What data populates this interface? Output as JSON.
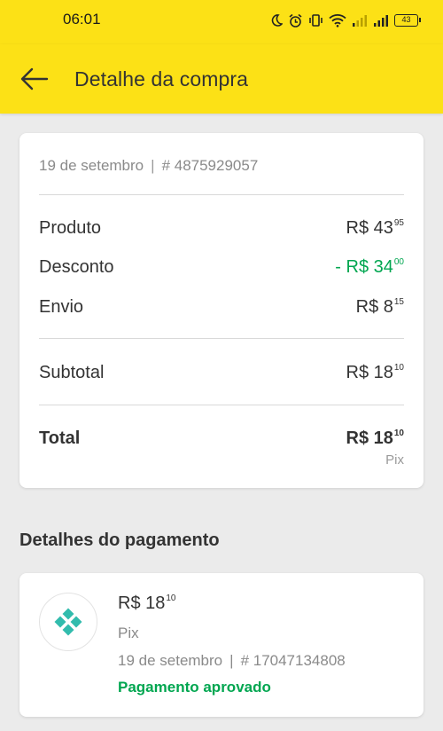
{
  "status_bar": {
    "time": "06:01",
    "battery": "43"
  },
  "header": {
    "title": "Detalhe da compra"
  },
  "order": {
    "date": "19 de setembro",
    "separator": "|",
    "number": "# 4875929057"
  },
  "summary": {
    "produto": {
      "label": "Produto",
      "amount": "R$ 43",
      "cents": "95"
    },
    "desconto": {
      "label": "Desconto",
      "amount": "- R$ 34",
      "cents": "00",
      "color": "#00a650"
    },
    "envio": {
      "label": "Envio",
      "amount": "R$ 8",
      "cents": "15"
    },
    "subtotal": {
      "label": "Subtotal",
      "amount": "R$ 18",
      "cents": "10"
    },
    "total": {
      "label": "Total",
      "amount": "R$ 18",
      "cents": "10",
      "method": "Pix"
    }
  },
  "payment_section": {
    "title": "Detalhes do pagamento",
    "icon": "pix-icon",
    "amount": "R$ 18",
    "cents": "10",
    "method": "Pix",
    "date": "19 de setembro",
    "separator": "|",
    "transaction": "# 17047134808",
    "status": "Pagamento aprovado",
    "status_color": "#00a650"
  },
  "colors": {
    "brand_yellow": "#fce116",
    "accent_green": "#00a650",
    "pix_teal": "#32bcad"
  }
}
